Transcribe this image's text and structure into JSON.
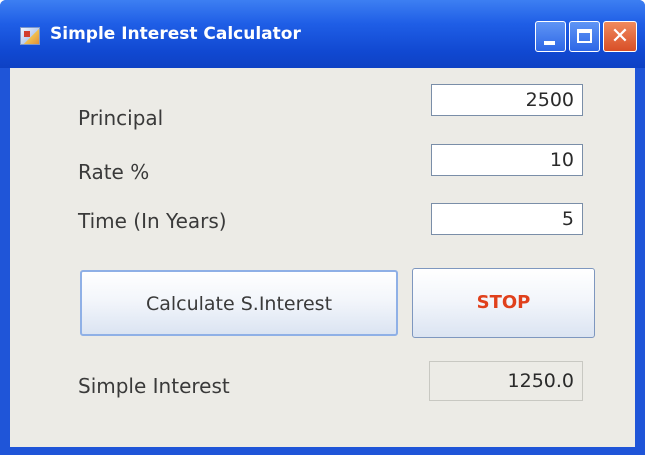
{
  "window": {
    "title": "Simple Interest Calculator",
    "icons": {
      "app": "java-app-icon",
      "minimize": "minimize-icon",
      "maximize": "maximize-icon",
      "close": "close-icon"
    },
    "close_glyph": "✕"
  },
  "form": {
    "principal": {
      "label": "Principal",
      "value": "2500"
    },
    "rate": {
      "label": "Rate %",
      "value": "10"
    },
    "time": {
      "label": "Time (In Years)",
      "value": "5"
    }
  },
  "buttons": {
    "calculate_label": "Calculate S.Interest",
    "stop_label": "STOP"
  },
  "result": {
    "label": "Simple Interest",
    "value": "1250.0"
  },
  "colors": {
    "titlebar": "#1f5ee6",
    "content_background": "#ecebe6",
    "stop_text": "#e0401c"
  }
}
